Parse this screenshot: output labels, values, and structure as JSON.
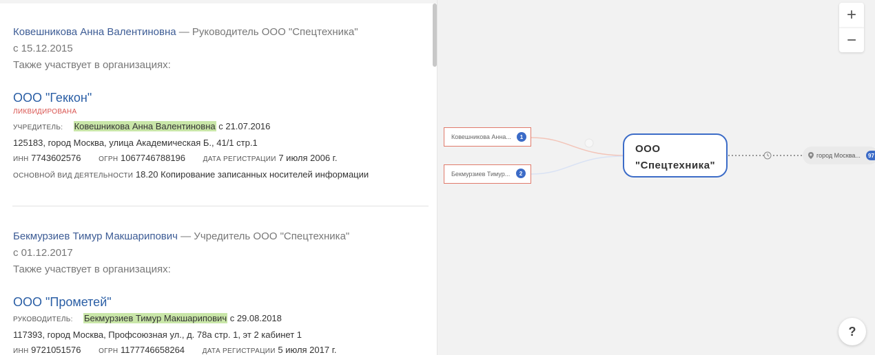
{
  "persons": [
    {
      "name": "Ковешникова Анна Валентиновна",
      "role": " — Руководитель ООО \"Спецтехника\"",
      "since": "с 15.12.2015",
      "also": "Также участвует в организациях:"
    },
    {
      "name": "Бекмурзиев Тимур Макшарипович",
      "role": " — Учредитель ООО \"Спецтехника\"",
      "since": "с 01.12.2017",
      "also": "Также участвует в организациях:"
    }
  ],
  "orgs": [
    {
      "name": "ООО \"Геккон\"",
      "status": "ликвидирована",
      "relation_label": "учредитель:",
      "relation_person": "Ковешникова Анна Валентиновна",
      "relation_since": " с 21.07.2016",
      "address": "125183, город Москва, улица Академическая Б., 41/1 стр.1",
      "inn_label": "инн",
      "inn": "7743602576",
      "ogrn_label": "огрн",
      "ogrn": "1067746788196",
      "reg_label": "дата регистрации",
      "reg_date": "7 июля 2006 г.",
      "activity_label": "основной вид деятельности",
      "activity": "18.20 Копирование записанных носителей информации"
    },
    {
      "name": "ООО \"Прометей\"",
      "relation_label": "руководитель:",
      "relation_person": "Бекмурзиев Тимур Макшарипович",
      "relation_since": " с 29.08.2018",
      "address": "117393, город Москва, Профсоюзная ул., д. 78а стр. 1, эт 2 кабинет 1",
      "inn_label": "инн",
      "inn": "9721051576",
      "ogrn_label": "огрн",
      "ogrn": "1177746658264",
      "reg_label": "дата регистрации",
      "reg_date": "5 июля 2017 г."
    }
  ],
  "graph": {
    "person_nodes": [
      {
        "label": "Ковешникова Анна...",
        "badge": "1"
      },
      {
        "label": "Бекмурзиев Тимур...",
        "badge": "2"
      }
    ],
    "main_node": {
      "line1": "ООО",
      "line2": "\"Спецтехника\""
    },
    "address_node": {
      "label": "город Москва...",
      "badge": "97"
    },
    "zoom_in": "+",
    "zoom_out": "−",
    "help": "?"
  },
  "colors": {
    "link": "#2a5ea5",
    "highlight": "#c9e6a8",
    "liquidated": "#d9534f",
    "node_border": "#3b6bc7",
    "person_node_border": "#e07a6a"
  },
  "icons": {
    "clock": "clock-icon",
    "location": "map-pin-icon"
  }
}
